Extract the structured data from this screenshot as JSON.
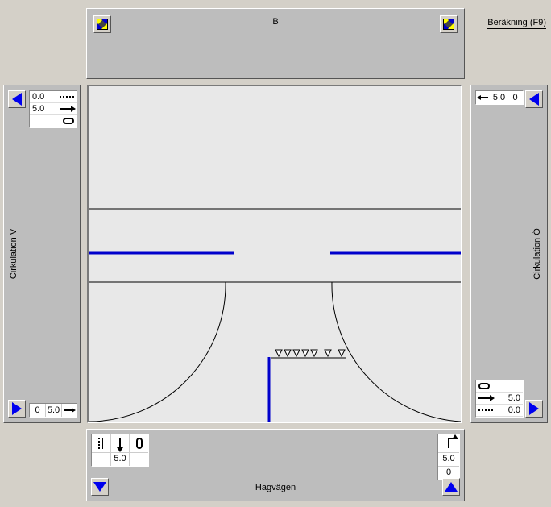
{
  "top": {
    "label": "B"
  },
  "left": {
    "label": "Cirkulation V"
  },
  "right": {
    "label": "Cirkulation Ö"
  },
  "bottom": {
    "label": "Hagvägen"
  },
  "calc_button": "Beräkning (F9)",
  "left_top_box": {
    "val1": "0.0",
    "val2": "5.0"
  },
  "left_bot_box": {
    "val1": "0",
    "val2": "5.0"
  },
  "right_top_box": {
    "val1": "5.0",
    "val2": "0"
  },
  "right_bot_box": {
    "val1": "5.0",
    "val2": "0.0"
  },
  "bottom_left_box": {
    "val1": "5.0"
  },
  "bottom_right_box": {
    "val1": "5.0",
    "val2": "0"
  }
}
